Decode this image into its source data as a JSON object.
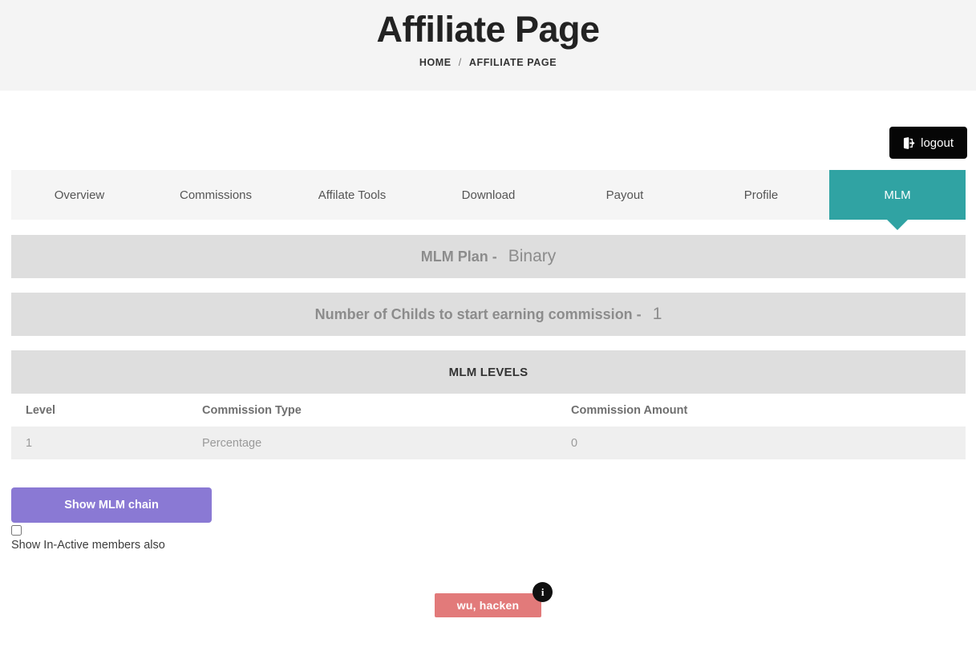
{
  "header": {
    "title": "Affiliate Page",
    "breadcrumb": {
      "home": "HOME",
      "separator": "/",
      "current": "AFFILIATE PAGE"
    }
  },
  "toolbar": {
    "logout_label": "logout",
    "logout_icon": "sign-out-icon"
  },
  "tabs": [
    {
      "label": "Overview",
      "active": false
    },
    {
      "label": "Commissions",
      "active": false
    },
    {
      "label": "Affilate Tools",
      "active": false
    },
    {
      "label": "Download",
      "active": false
    },
    {
      "label": "Payout",
      "active": false
    },
    {
      "label": "Profile",
      "active": false
    },
    {
      "label": "MLM",
      "active": true
    }
  ],
  "plan": {
    "label": "MLM Plan -",
    "value": "Binary"
  },
  "childs": {
    "label": "Number of Childs to start earning commission -",
    "value": "1"
  },
  "levels": {
    "title": "MLM LEVELS",
    "columns": [
      "Level",
      "Commission Type",
      "Commission Amount"
    ],
    "rows": [
      {
        "level": "1",
        "type": "Percentage",
        "amount": "0"
      }
    ]
  },
  "actions": {
    "show_chain_label": "Show MLM chain",
    "inactive_checkbox_label": "Show In-Active members also",
    "inactive_checked": false
  },
  "chain": {
    "nodes": [
      {
        "name": "wu, hacken",
        "badge": "i"
      }
    ]
  },
  "colors": {
    "header_band": "#f4f4f4",
    "tab_active": "#30a3a3",
    "info_band": "#dedede",
    "chain_button": "#8a79d4",
    "node": "#e27a7a",
    "badge": "#101010",
    "logout": "#060606",
    "table_row": "#efefef"
  }
}
